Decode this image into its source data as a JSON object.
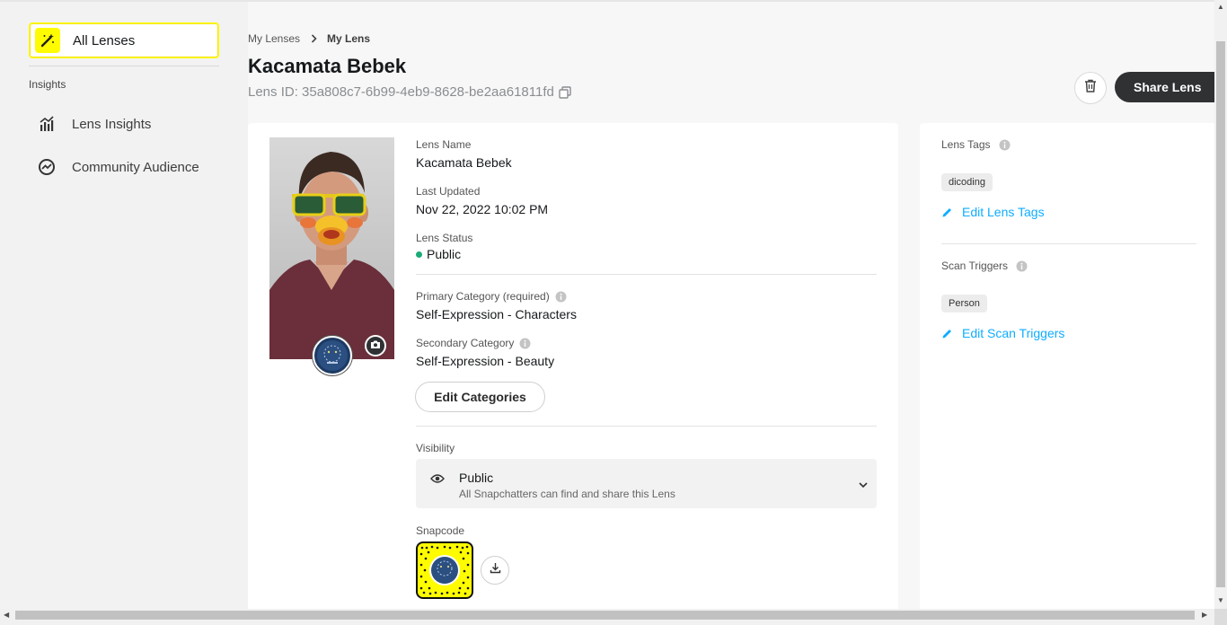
{
  "sidebar": {
    "all_lenses_label": "All Lenses",
    "section_label": "Insights",
    "items": [
      {
        "label": "Lens Insights",
        "icon": "bar-chart-icon"
      },
      {
        "label": "Community Audience",
        "icon": "trend-circle-icon"
      }
    ]
  },
  "header": {
    "breadcrumb": [
      "My Lenses",
      "My Lens"
    ],
    "title": "Kacamata Bebek",
    "lens_id": "Lens ID: 35a808c7-6b99-4eb9-8628-be2aa61811fd",
    "share_label": "Share Lens"
  },
  "details": {
    "lens_name_label": "Lens Name",
    "lens_name": "Kacamata Bebek",
    "last_updated_label": "Last Updated",
    "last_updated": "Nov 22, 2022 10:02 PM",
    "status_label": "Lens Status",
    "status": "Public",
    "status_color": "#1aab78",
    "primary_category_label": "Primary Category (required)",
    "primary_category": "Self-Expression - Characters",
    "secondary_category_label": "Secondary Category",
    "secondary_category": "Self-Expression - Beauty",
    "edit_categories_label": "Edit Categories",
    "visibility_label": "Visibility",
    "visibility_value": "Public",
    "visibility_description": "All Snapchatters can find and share this Lens",
    "snapcode_label": "Snapcode"
  },
  "side": {
    "tags_label": "Lens Tags",
    "tags": [
      "dicoding"
    ],
    "edit_tags_label": "Edit Lens Tags",
    "triggers_label": "Scan Triggers",
    "triggers": [
      "Person"
    ],
    "edit_triggers_label": "Edit Scan Triggers"
  },
  "colors": {
    "accent_yellow": "#fffc00",
    "link_blue": "#0fadff",
    "dark_button": "#2f3133"
  }
}
